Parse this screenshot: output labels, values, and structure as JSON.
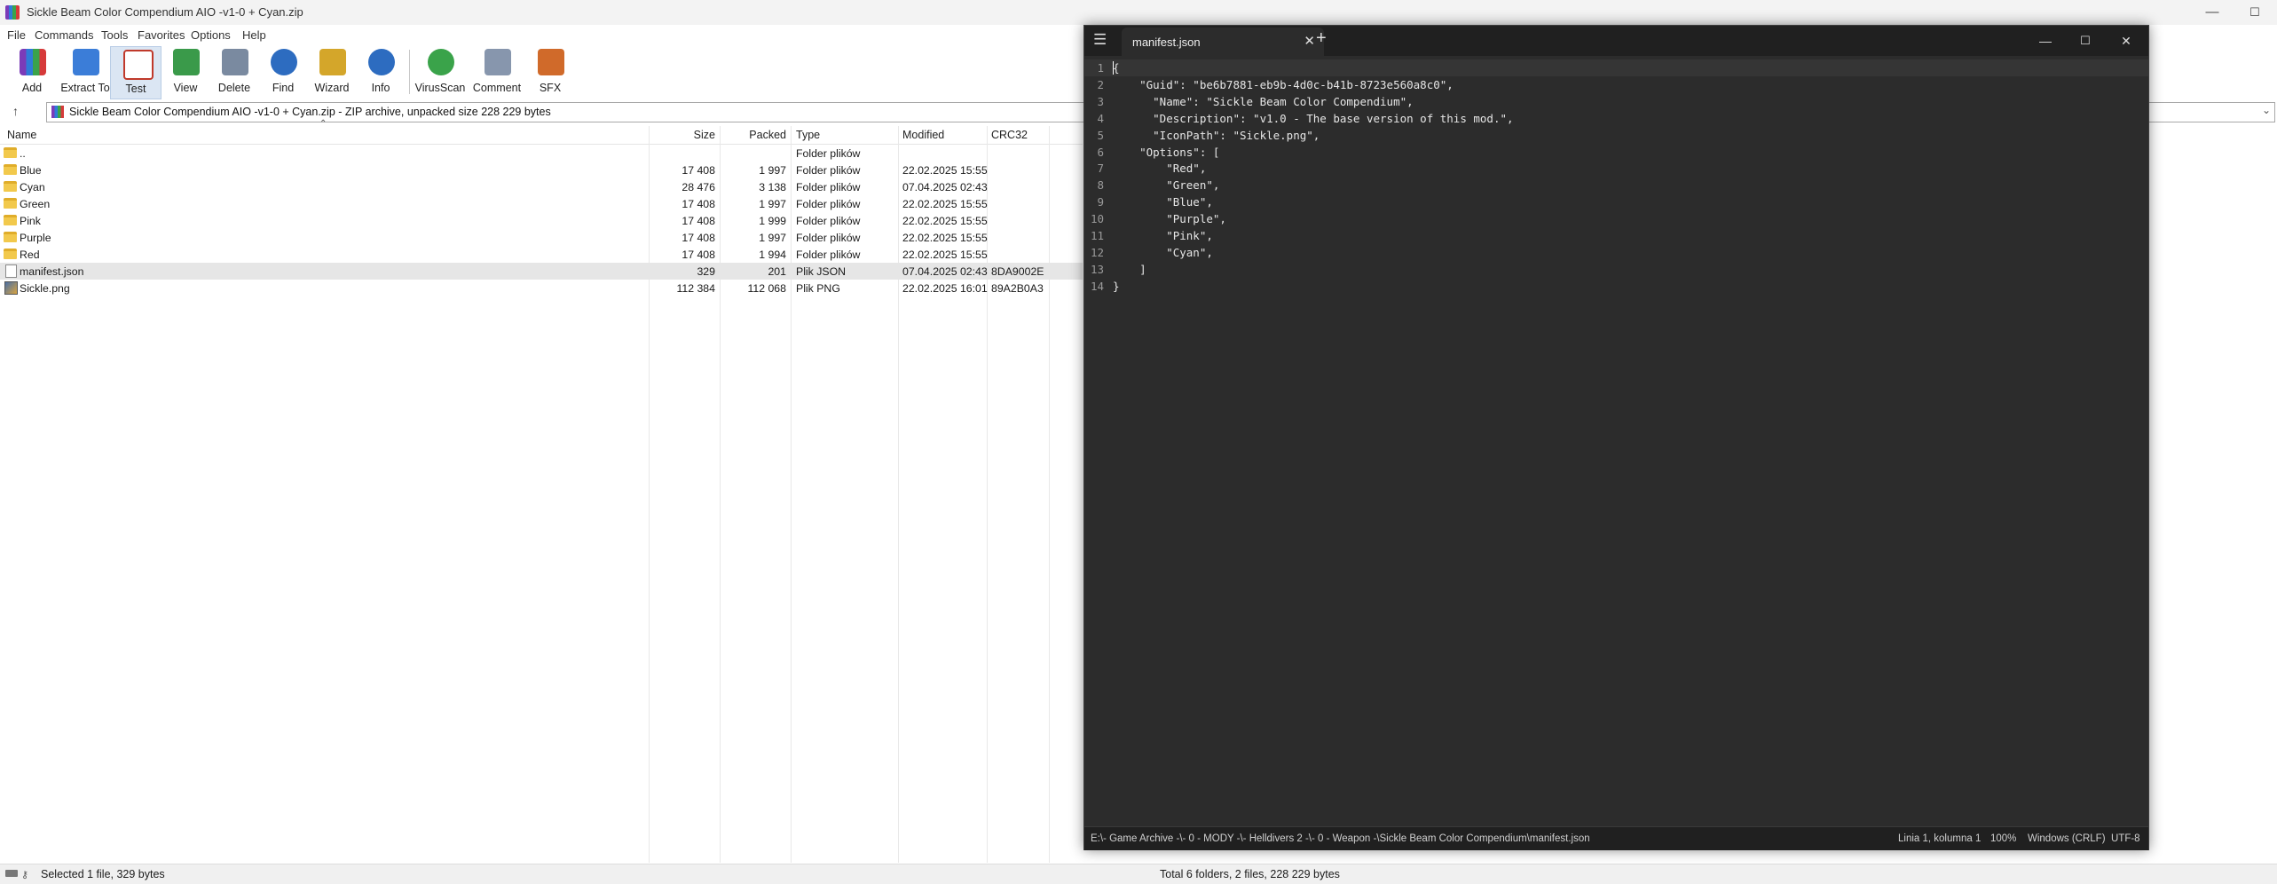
{
  "rar": {
    "title": "Sickle Beam Color Compendium AIO -v1-0 + Cyan.zip",
    "window_controls": {
      "minimize": "—",
      "maximize": "☐",
      "close": "✕"
    },
    "menu": [
      "File",
      "Commands",
      "Tools",
      "Favorites",
      "Options",
      "Help"
    ],
    "toolbar": [
      {
        "label": "Add",
        "icon": "add-archive-icon",
        "color": "#c0392b"
      },
      {
        "label": "Extract To",
        "icon": "extract-folder-icon",
        "color": "#3b7dd8"
      },
      {
        "label": "Test",
        "icon": "test-clipboard-icon",
        "color": "#c0392b"
      },
      {
        "label": "View",
        "icon": "view-book-icon",
        "color": "#3a9a4a"
      },
      {
        "label": "Delete",
        "icon": "delete-bin-icon",
        "color": "#7a8aa0"
      },
      {
        "label": "Find",
        "icon": "find-magnifier-icon",
        "color": "#2d6cc0"
      },
      {
        "label": "Wizard",
        "icon": "wizard-wand-icon",
        "color": "#d4a62a"
      },
      {
        "label": "Info",
        "icon": "info-icon",
        "color": "#2d6cc0"
      },
      {
        "label": "VirusScan",
        "icon": "virusscan-icon",
        "color": "#3aa34a"
      },
      {
        "label": "Comment",
        "icon": "comment-icon",
        "color": "#8796ad"
      },
      {
        "label": "SFX",
        "icon": "sfx-package-icon",
        "color": "#d06a2a"
      }
    ],
    "address": "Sickle Beam Color Compendium AIO -v1-0 + Cyan.zip - ZIP archive, unpacked size 228 229 bytes",
    "columns": {
      "name": "Name",
      "size": "Size",
      "packed": "Packed",
      "type": "Type",
      "modified": "Modified",
      "crc": "CRC32"
    },
    "rows": [
      {
        "name": "..",
        "size": "",
        "packed": "",
        "type": "Folder plików",
        "modified": "",
        "crc": "",
        "kind": "folder"
      },
      {
        "name": "Blue",
        "size": "17 408",
        "packed": "1 997",
        "type": "Folder plików",
        "modified": "22.02.2025 15:55",
        "crc": "",
        "kind": "folder"
      },
      {
        "name": "Cyan",
        "size": "28 476",
        "packed": "3 138",
        "type": "Folder plików",
        "modified": "07.04.2025 02:43",
        "crc": "",
        "kind": "folder"
      },
      {
        "name": "Green",
        "size": "17 408",
        "packed": "1 997",
        "type": "Folder plików",
        "modified": "22.02.2025 15:55",
        "crc": "",
        "kind": "folder"
      },
      {
        "name": "Pink",
        "size": "17 408",
        "packed": "1 999",
        "type": "Folder plików",
        "modified": "22.02.2025 15:55",
        "crc": "",
        "kind": "folder"
      },
      {
        "name": "Purple",
        "size": "17 408",
        "packed": "1 997",
        "type": "Folder plików",
        "modified": "22.02.2025 15:55",
        "crc": "",
        "kind": "folder"
      },
      {
        "name": "Red",
        "size": "17 408",
        "packed": "1 994",
        "type": "Folder plików",
        "modified": "22.02.2025 15:55",
        "crc": "",
        "kind": "folder"
      },
      {
        "name": "manifest.json",
        "size": "329",
        "packed": "201",
        "type": "Plik JSON",
        "modified": "07.04.2025 02:43",
        "crc": "8DA9002E",
        "kind": "json",
        "selected": true
      },
      {
        "name": "Sickle.png",
        "size": "112 384",
        "packed": "112 068",
        "type": "Plik PNG",
        "modified": "22.02.2025 16:01",
        "crc": "89A2B0A3",
        "kind": "png"
      }
    ],
    "status_left": "Selected 1 file, 329 bytes",
    "status_right": "Total 6 folders, 2 files, 228 229 bytes"
  },
  "notepad": {
    "tab_title": "manifest.json",
    "window_controls": {
      "minimize": "—",
      "maximize": "☐",
      "close": "✕"
    },
    "lines": [
      "{",
      "    \"Guid\": \"be6b7881-eb9b-4d0c-b41b-8723e560a8c0\",",
      "      \"Name\": \"Sickle Beam Color Compendium\",",
      "      \"Description\": \"v1.0 - The base version of this mod.\",",
      "      \"IconPath\": \"Sickle.png\",",
      "    \"Options\": [",
      "        \"Red\",",
      "        \"Green\",",
      "        \"Blue\",",
      "        \"Purple\",",
      "        \"Pink\",",
      "        \"Cyan\",",
      "    ]",
      "}"
    ],
    "status_path": "E:\\- Game Archive -\\- 0 - MODY -\\- Helldivers 2 -\\- 0 - Weapon -\\Sickle Beam Color Compendium\\manifest.json",
    "status_position": "Linia 1, kolumna 1",
    "status_zoom": "100%",
    "status_eol": "Windows (CRLF)",
    "status_encoding": "UTF-8"
  }
}
